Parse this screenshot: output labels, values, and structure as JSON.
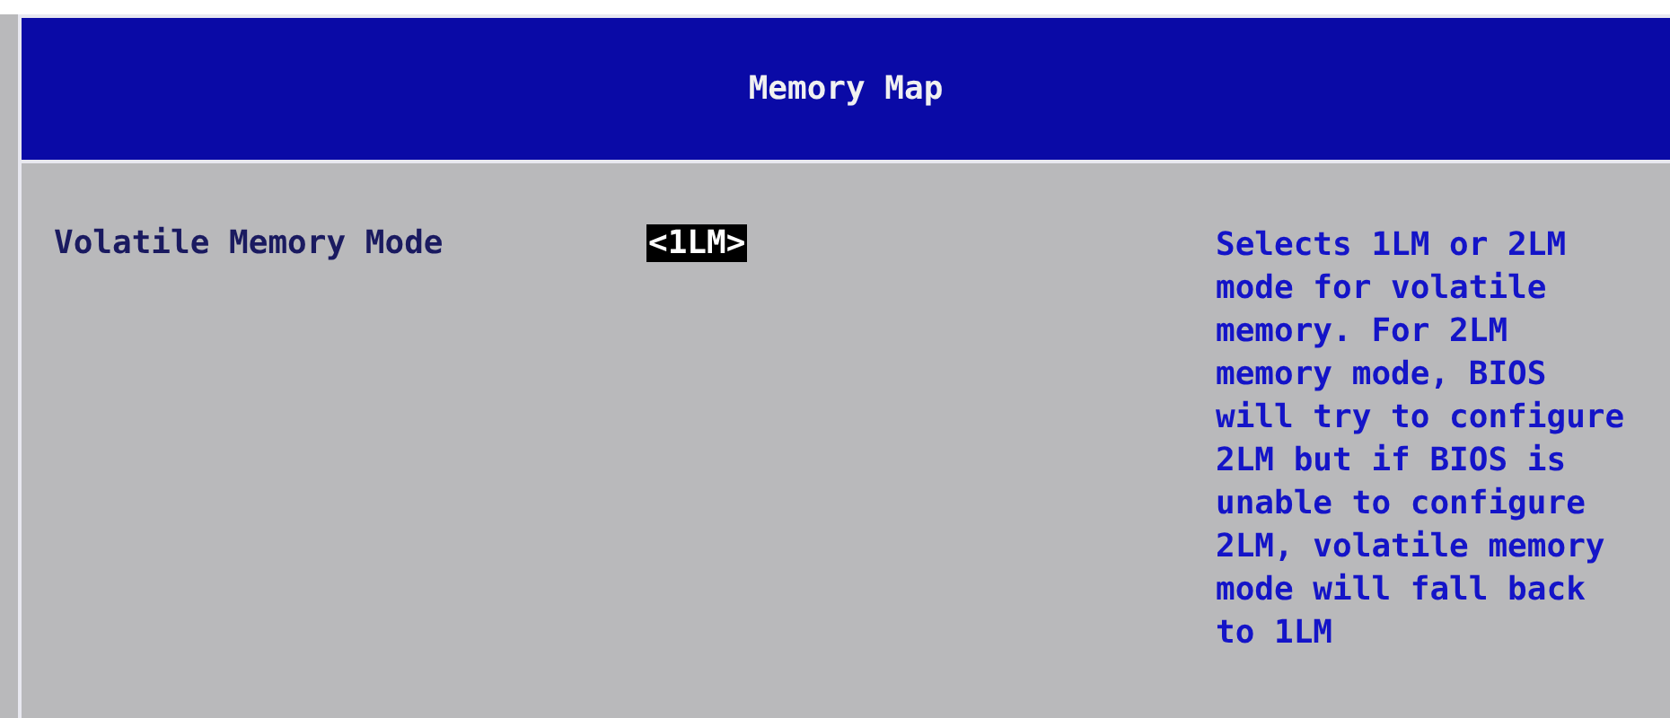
{
  "header": {
    "title": "Memory Map"
  },
  "settings": [
    {
      "label": "Volatile Memory Mode",
      "value": "<1LM>",
      "selected": true
    }
  ],
  "help": {
    "lines": [
      "Selects 1LM or 2LM",
      "mode for volatile",
      "memory. For 2LM",
      "memory mode, BIOS",
      "will try to configure",
      "2LM but if BIOS is",
      "unable to configure",
      "2LM, volatile memory",
      "mode will fall back",
      "to 1LM"
    ]
  }
}
